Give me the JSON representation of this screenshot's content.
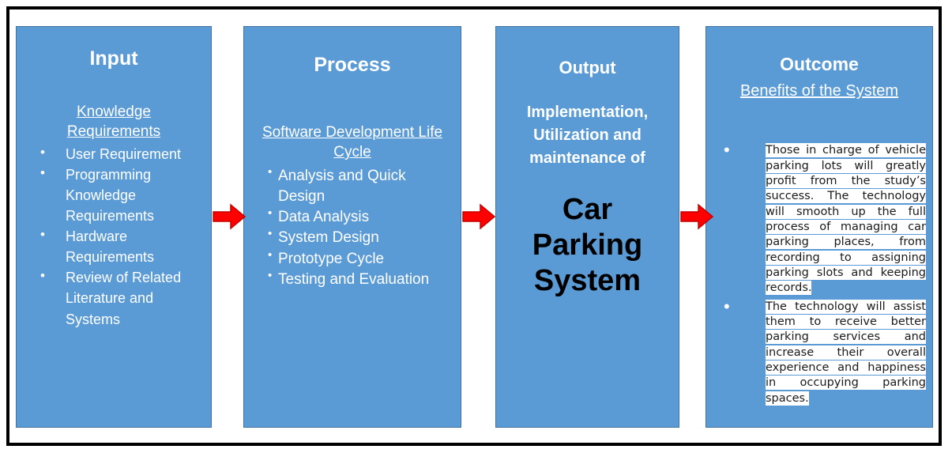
{
  "diagram": {
    "colors": {
      "box_fill": "#5B9BD5",
      "box_border": "#41719C",
      "arrow_fill": "#FF0000",
      "frame": "#000000",
      "title_text": "#FFFFFF",
      "highlight_bg": "#FFFFFF"
    },
    "stages": [
      {
        "id": "input",
        "title": "Input",
        "subtitle": "Knowledge Requirements",
        "bullets": [
          "User Requirement",
          "Programming Knowledge Requirements",
          "Hardware Requirements",
          "Review of Related Literature and Systems"
        ]
      },
      {
        "id": "process",
        "title": "Process",
        "subtitle": "Software Development Life Cycle",
        "bullets": [
          "Analysis and Quick Design",
          "Data Analysis",
          "System Design",
          "Prototype Cycle",
          "Testing and Evaluation"
        ]
      },
      {
        "id": "output",
        "title": "Output",
        "lead": "Implementation, Utilization and maintenance of",
        "main": "Car Parking System"
      },
      {
        "id": "outcome",
        "title": "Outcome",
        "subtitle": "Benefits of the System",
        "bullets": [
          "Those in charge of vehicle parking lots will greatly profit from the study’s success. The technology will smooth up the full process of managing car parking places, from recording to assigning parking slots and keeping records.",
          "The technology will assist them to receive better parking services and increase their overall experience and happiness in occupying parking spaces."
        ]
      }
    ],
    "arrows": [
      {
        "name": "arrow-input-to-process",
        "direction": "right"
      },
      {
        "name": "arrow-process-to-output",
        "direction": "right"
      },
      {
        "name": "arrow-output-to-outcome",
        "direction": "right"
      }
    ]
  }
}
